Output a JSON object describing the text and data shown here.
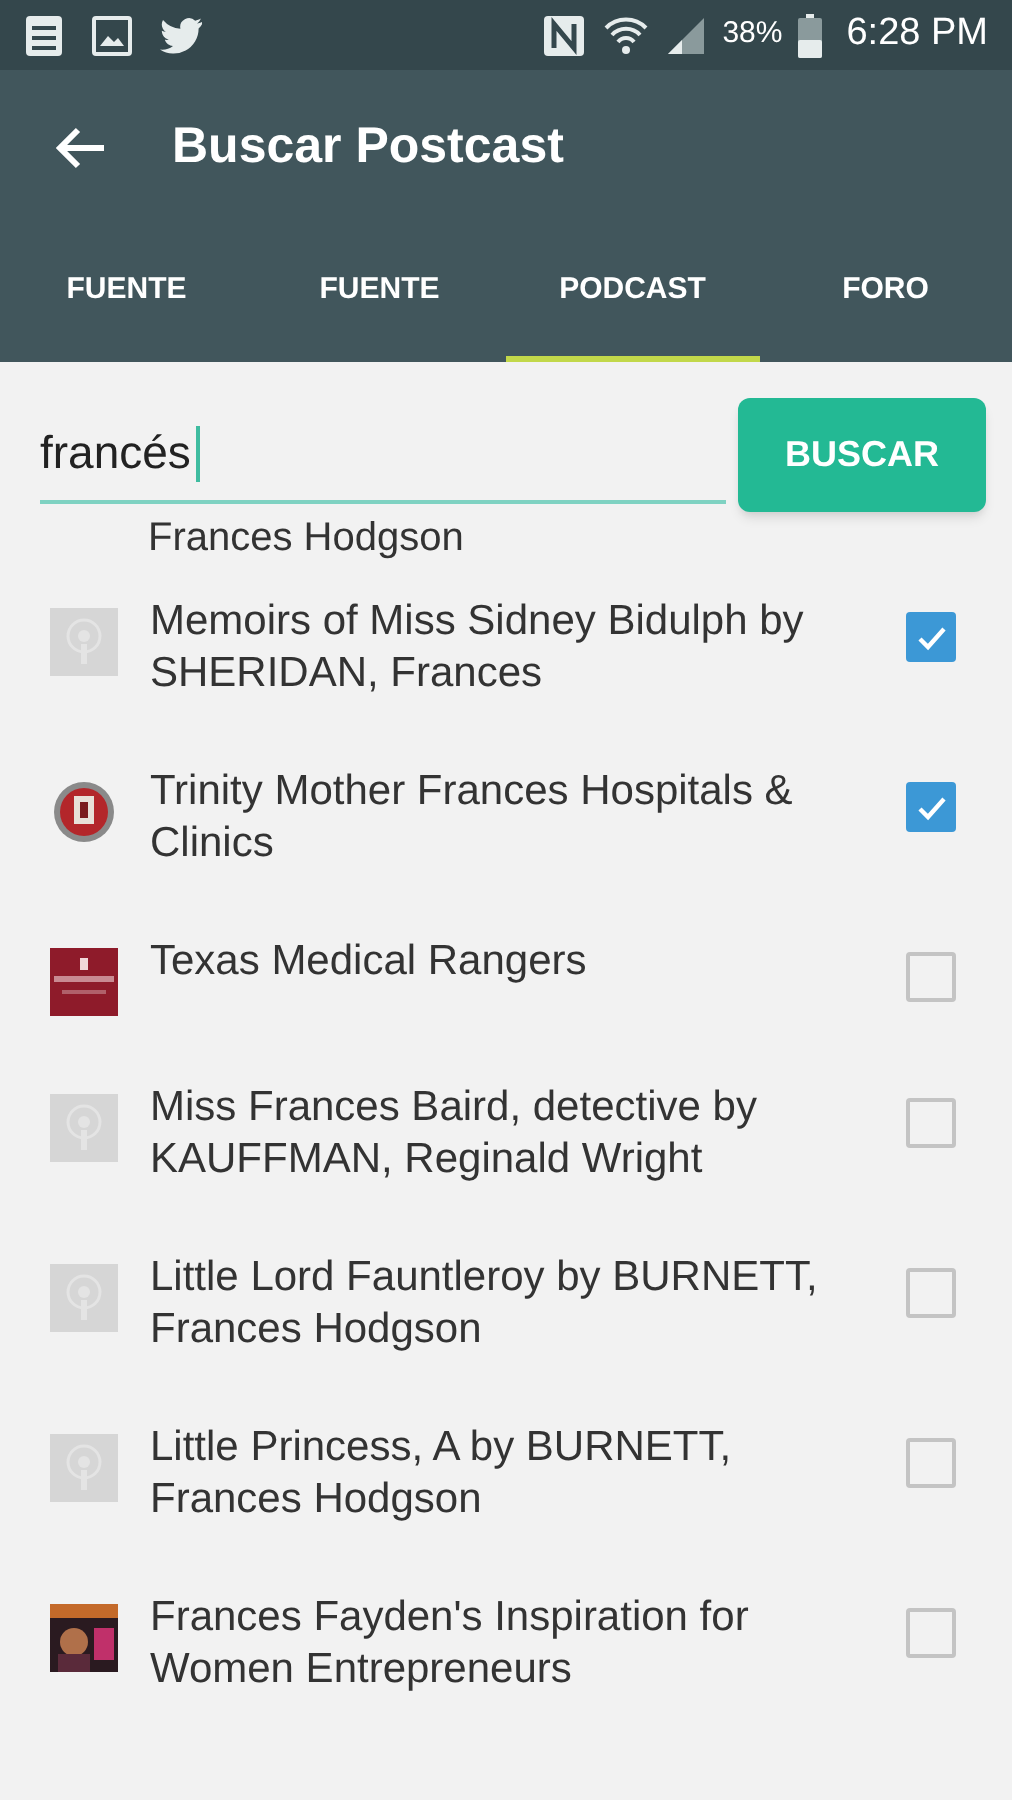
{
  "status_bar": {
    "battery": "38%",
    "time": "6:28 PM"
  },
  "app_bar": {
    "title": "Buscar Postcast"
  },
  "tabs": [
    {
      "label": "FUENTE",
      "selected": false
    },
    {
      "label": "FUENTE",
      "selected": false
    },
    {
      "label": "PODCAST",
      "selected": true
    },
    {
      "label": "FORO",
      "selected": false
    }
  ],
  "search": {
    "value": "francés",
    "button": "BUSCAR"
  },
  "partial_row": {
    "title": "Frances Hodgson"
  },
  "results": [
    {
      "title": "Memoirs of Miss Sidney Bidulph by SHERIDAN, Frances",
      "kind": "placeholder",
      "checked": true
    },
    {
      "title": "Trinity Mother Frances Hospitals & Clinics",
      "kind": "round",
      "checked": true
    },
    {
      "title": "Texas Medical Rangers",
      "kind": "red",
      "checked": false
    },
    {
      "title": "Miss Frances Baird, detective by KAUFFMAN, Reginald Wright",
      "kind": "placeholder",
      "checked": false
    },
    {
      "title": "Little Lord Fauntleroy by BURNETT, Frances Hodgson",
      "kind": "placeholder",
      "checked": false
    },
    {
      "title": "Little Princess, A by BURNETT, Frances Hodgson",
      "kind": "placeholder",
      "checked": false
    },
    {
      "title": "Frances Fayden's Inspiration for Women Entrepreneurs",
      "checked": false
    }
  ]
}
